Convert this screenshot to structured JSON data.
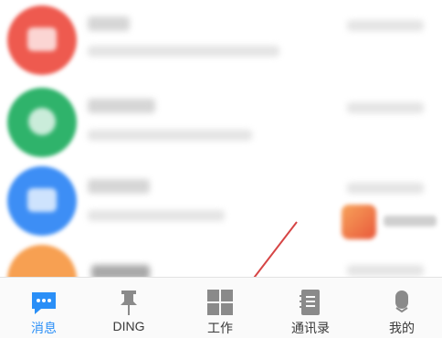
{
  "tabbar": {
    "tabs": [
      {
        "label": "消息",
        "icon": "message-bubble-icon",
        "active": true
      },
      {
        "label": "DING",
        "icon": "pin-icon",
        "active": false
      },
      {
        "label": "工作",
        "icon": "grid-icon",
        "active": false
      },
      {
        "label": "通讯录",
        "icon": "contacts-book-icon",
        "active": false
      },
      {
        "label": "我的",
        "icon": "profile-icon",
        "active": false
      }
    ]
  },
  "colors": {
    "accent": "#2a8ff7",
    "inactive_icon": "#8a8a8a",
    "annotation_arrow": "#d64545",
    "avatar_red": "#ee5a4f",
    "avatar_green": "#2fb36b",
    "avatar_blue": "#3d8ef5",
    "avatar_orange": "#f7a052"
  }
}
